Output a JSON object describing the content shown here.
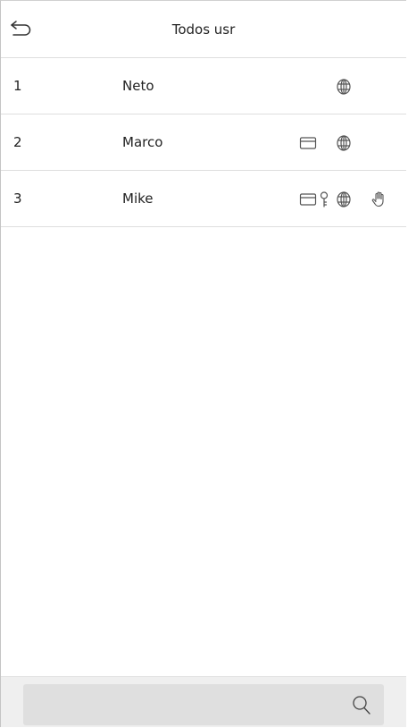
{
  "header": {
    "title": "Todos usr",
    "back_icon": "back-arrow-icon"
  },
  "users": [
    {
      "number": "1",
      "name": "Neto",
      "verify_methods": [
        "face"
      ]
    },
    {
      "number": "2",
      "name": "Marco",
      "verify_methods": [
        "card",
        "face"
      ]
    },
    {
      "number": "3",
      "name": "Mike",
      "verify_methods": [
        "card",
        "password",
        "face",
        "palm"
      ]
    }
  ],
  "search": {
    "placeholder": "",
    "value": "",
    "icon": "search-icon"
  },
  "colors": {
    "icon_stroke": "#555555",
    "divider": "#dedede",
    "footer_bg": "#efefef",
    "search_bg": "#dfdfdf"
  }
}
